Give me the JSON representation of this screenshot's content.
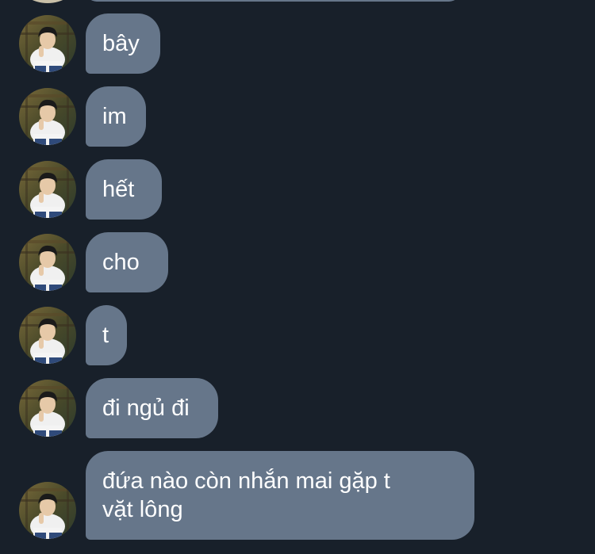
{
  "conversation": {
    "messages": [
      {
        "text": "bây"
      },
      {
        "text": "im"
      },
      {
        "text": "hết"
      },
      {
        "text": "cho"
      },
      {
        "text": "t"
      },
      {
        "text": "đi ngủ đi"
      },
      {
        "text": "đứa nào còn nhắn mai gặp t\nvặt lông"
      }
    ]
  },
  "colors": {
    "background": "#18202a",
    "bubble": "#66768a",
    "text": "#ffffff"
  }
}
